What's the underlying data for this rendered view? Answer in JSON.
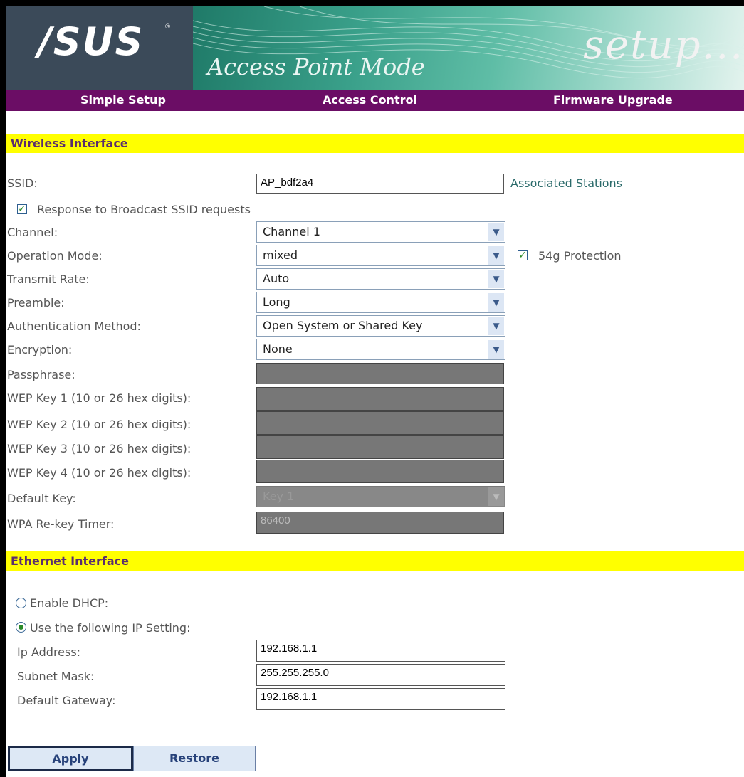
{
  "header": {
    "logo": "/SUS",
    "mode_title": "Access Point Mode",
    "setup_text": "setup..."
  },
  "nav": {
    "items": [
      "Simple Setup",
      "Access Control",
      "Firmware Upgrade"
    ]
  },
  "wireless": {
    "section_title": "Wireless Interface",
    "ssid_label": "SSID:",
    "ssid_value": "AP_bdf2a4",
    "associated_link": "Associated Stations",
    "broadcast_label": "Response to Broadcast SSID requests",
    "broadcast_checked": true,
    "channel_label": "Channel:",
    "channel_value": "Channel 1",
    "opmode_label": "Operation Mode:",
    "opmode_value": "mixed",
    "protection_label": "54g Protection",
    "protection_checked": true,
    "rate_label": "Transmit Rate:",
    "rate_value": "Auto",
    "preamble_label": "Preamble:",
    "preamble_value": "Long",
    "auth_label": "Authentication Method:",
    "auth_value": "Open System or Shared Key",
    "encryption_label": "Encryption:",
    "encryption_value": "None",
    "passphrase_label": "Passphrase:",
    "wep1_label": "WEP Key 1 (10 or 26 hex digits):",
    "wep2_label": "WEP Key 2 (10 or 26 hex digits):",
    "wep3_label": "WEP Key 3 (10 or 26 hex digits):",
    "wep4_label": "WEP Key 4 (10 or 26 hex digits):",
    "default_key_label": "Default Key:",
    "default_key_value": "Key 1",
    "rekey_label": "WPA Re-key Timer:",
    "rekey_value": "86400"
  },
  "ethernet": {
    "section_title": "Ethernet Interface",
    "dhcp_label": "Enable DHCP:",
    "static_label": "Use the following IP Setting:",
    "selected_mode": "static",
    "ip_label": "Ip Address:",
    "ip_value": "192.168.1.1",
    "subnet_label": "Subnet Mask:",
    "subnet_value": "255.255.255.0",
    "gateway_label": "Default Gateway:",
    "gateway_value": "192.168.1.1"
  },
  "buttons": {
    "apply": "Apply",
    "restore": "Restore"
  },
  "colors": {
    "nav_bg": "#6b0d65",
    "section_bg": "#ffff00",
    "logo_bg": "#3b4a59"
  }
}
